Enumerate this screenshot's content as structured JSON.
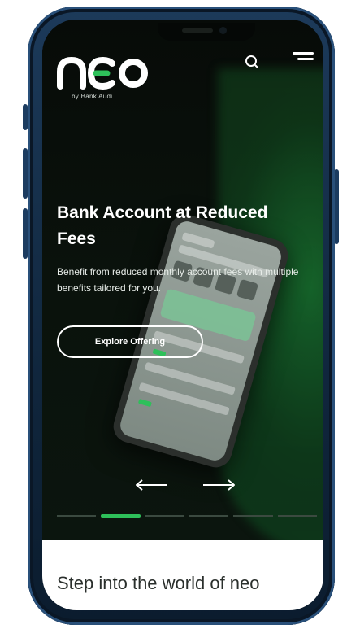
{
  "brand": {
    "logo_text": "neo",
    "tagline": "by Bank Audi",
    "accent_color": "#2ec05a"
  },
  "header": {
    "search_icon": "search-icon",
    "menu_icon": "hamburger-menu-icon"
  },
  "hero": {
    "title": "Bank Account at Reduced Fees",
    "description": "Benefit from reduced monthly account fees with multiple benefits tailored for you.",
    "cta_label": "Explore Offering",
    "prev_icon": "arrow-left-icon",
    "next_icon": "arrow-right-icon",
    "slides_total": 6,
    "active_slide": 2
  },
  "section": {
    "title": "Step into the world of neo"
  }
}
